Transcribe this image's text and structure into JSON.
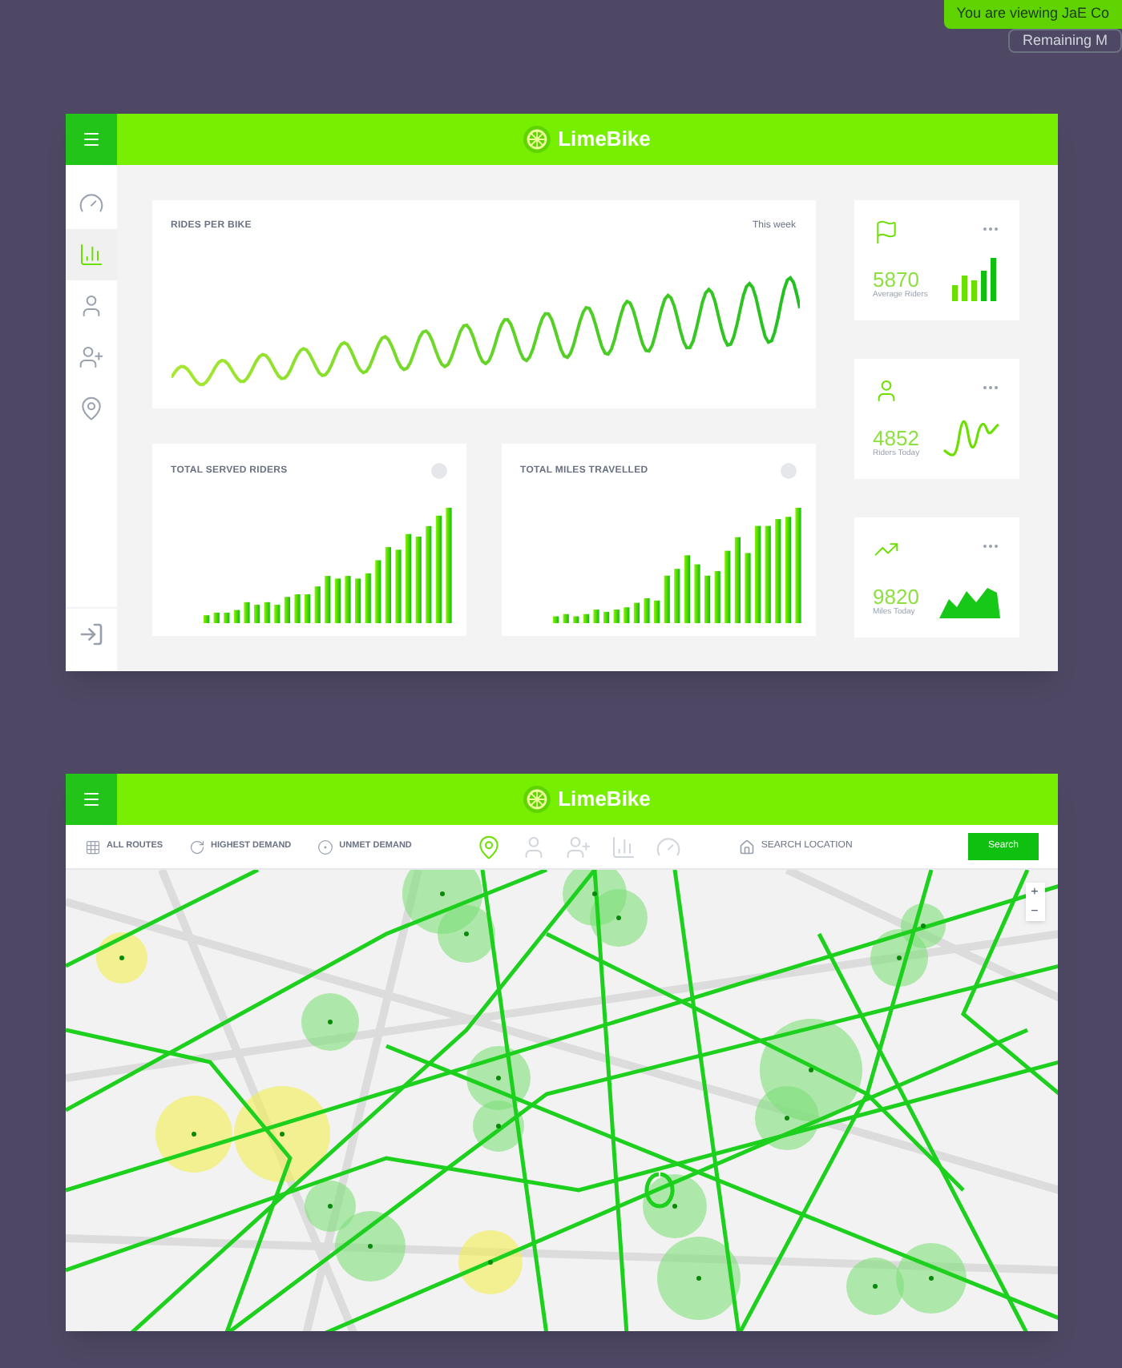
{
  "notice": {
    "text": "You are viewing JaE Co",
    "subtext": "Remaining M"
  },
  "dashboard": {
    "brand": "LimeBike",
    "sidebar": [
      {
        "kind": "gauge",
        "selected": false
      },
      {
        "kind": "bars",
        "selected": true
      },
      {
        "kind": "user",
        "selected": false
      },
      {
        "kind": "user-plus",
        "selected": false
      },
      {
        "kind": "pin",
        "selected": false
      }
    ],
    "rides_chart": {
      "title": "RIDES PER BIKE",
      "filter": "This week"
    },
    "stats": [
      {
        "kind": "flag",
        "value": "5870",
        "label": "Average Riders"
      },
      {
        "kind": "user",
        "value": "4852",
        "label": "Riders Today"
      },
      {
        "kind": "trend",
        "value": "9820",
        "label": "Miles Today"
      }
    ],
    "bar_charts": [
      {
        "title": "TOTAL SERVED RIDERS"
      },
      {
        "title": "TOTAL MILES TRAVELLED"
      }
    ]
  },
  "map_view": {
    "brand": "LimeBike",
    "filters": [
      {
        "kind": "grid",
        "label": "ALL ROUTES"
      },
      {
        "kind": "refresh",
        "label": "HIGHEST DEMAND"
      },
      {
        "kind": "target",
        "label": "UNMET DEMAND"
      }
    ],
    "tools": [
      {
        "kind": "pin",
        "selected": true
      },
      {
        "kind": "user",
        "selected": false
      },
      {
        "kind": "user-plus",
        "selected": false
      },
      {
        "kind": "bars",
        "selected": false
      },
      {
        "kind": "gauge",
        "selected": false
      }
    ],
    "search": {
      "placeholder": "SEARCH LOCATION",
      "button": "Search"
    },
    "zoom": [
      "+",
      "−"
    ]
  }
}
